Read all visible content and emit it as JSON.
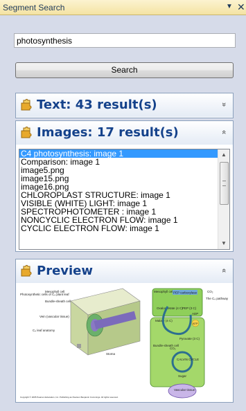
{
  "window": {
    "title": "Segment Search",
    "dropdown_glyph": "▼",
    "close_glyph": "✕"
  },
  "search": {
    "value": "photosynthesis",
    "button_label": "Search"
  },
  "panels": {
    "text": {
      "title": "Text: 43 result(s)",
      "toggle_glyph": "»",
      "icon": "puzzle-icon"
    },
    "images": {
      "title": "Images: 17 result(s)",
      "toggle_glyph": "«",
      "icon": "puzzle-icon",
      "items": [
        "C4 photosynthesis: image 1",
        "Comparison: image 1",
        "image5.png",
        "image15.png",
        "image16.png",
        "CHLOROPLAST STRUCTURE: image 1",
        "VISIBLE (WHITE) LIGHT: image 1",
        "SPECTROPHOTOMETER       : image 1",
        "NONCYCLIC ELECTRON FLOW: image 1",
        "CYCLIC ELECTRON FLOW: image 1"
      ],
      "selected_index": 0
    },
    "preview": {
      "title": "Preview",
      "toggle_glyph": "«",
      "icon": "puzzle-icon",
      "figure": {
        "left_label": "Photosynthetic cells of C₄ plant leaf",
        "mesophyll_cell": "Mesophyll cell",
        "bundle_sheath": "Bundle-sheath cell",
        "vein": "Vein (vascular tissue)",
        "anatomy": "C₄ leaf anatomy",
        "stoma": "Stoma",
        "right_mesophyll": "Mesophyll cell",
        "pep_carboxylase": "PEP carboxylase",
        "co2": "CO₂",
        "pathway": "The C₄ pathway",
        "oxaloacetate": "Oxaloacetate (4 C)",
        "pep": "PEP (3 C)",
        "adp": "ADP",
        "malate": "Malate (4 C)",
        "atp": "ATP",
        "bundle_sheath_cell": "Bundle-sheath cell",
        "pyruvate": "Pyruvate (3 C)",
        "co2_b": "CO₂",
        "calvin": "CALVIN CYCLE",
        "sugar": "Sugar",
        "vascular": "Vascular tissue",
        "copyright": "Copyright © 2005 Pearson Education, Inc. Publishing as Pearson Benjamin Cummings. All rights reserved."
      }
    }
  }
}
